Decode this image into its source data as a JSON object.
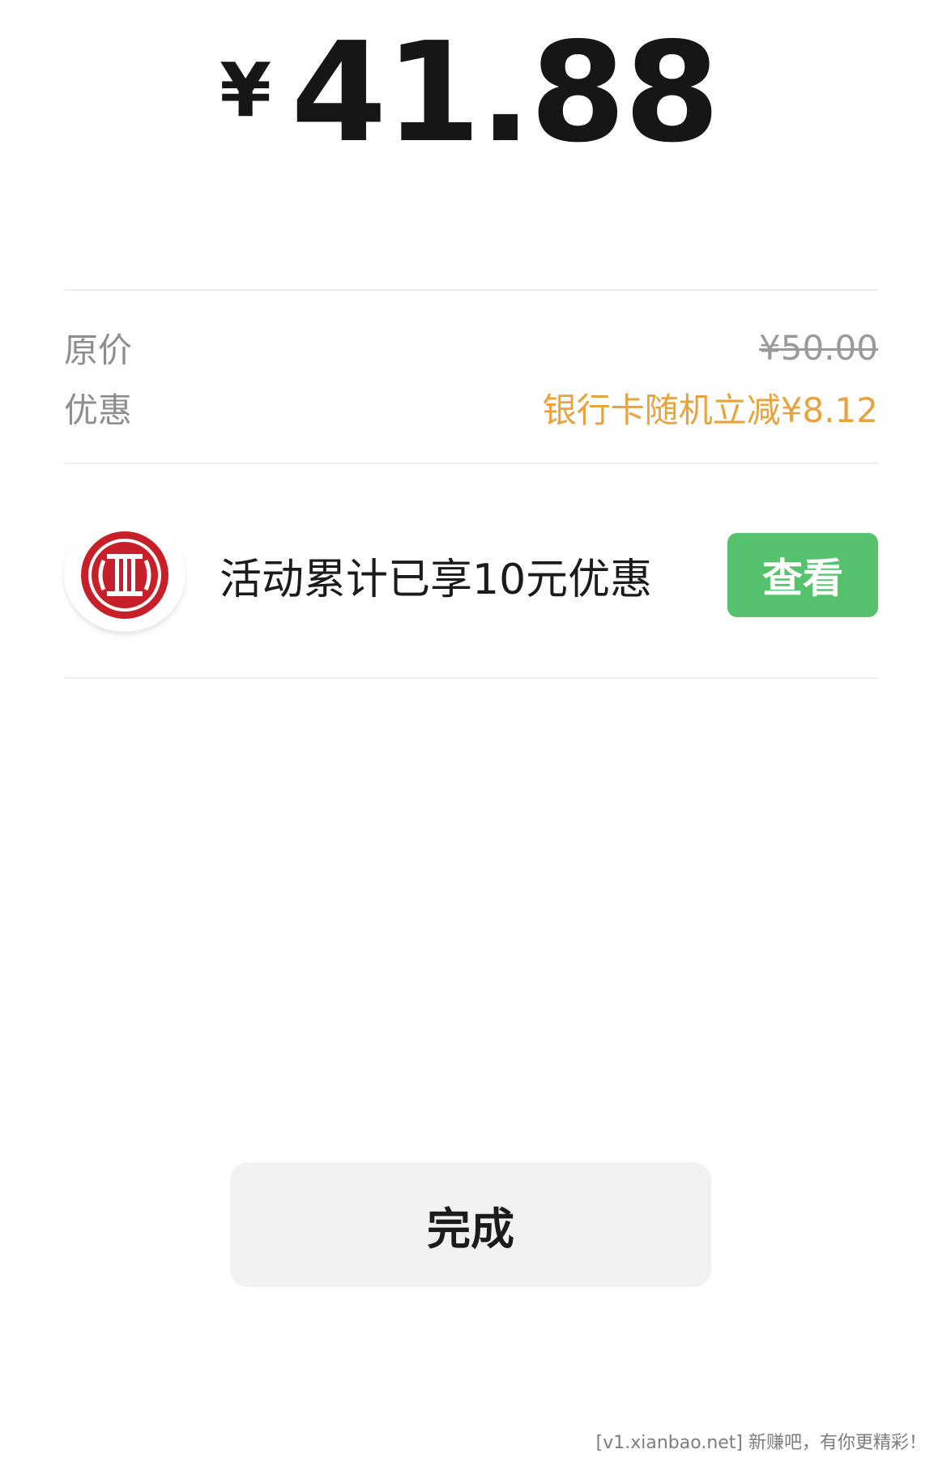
{
  "payment": {
    "currency_symbol": "¥",
    "amount": "41.88"
  },
  "details": {
    "original_label": "原价",
    "original_price": "¥50.00",
    "discount_label": "优惠",
    "discount_value": "银行卡随机立减¥8.12"
  },
  "promo": {
    "bank_logo": "citic-bank-logo",
    "text": "活动累计已享10元优惠",
    "view_label": "查看"
  },
  "footer": {
    "done_label": "完成"
  },
  "watermark": "[v1.xianbao.net] 新赚吧，有你更精彩！",
  "colors": {
    "accent_green": "#57c26e",
    "discount_orange": "#e6a33e",
    "bank_red": "#c8202a"
  }
}
